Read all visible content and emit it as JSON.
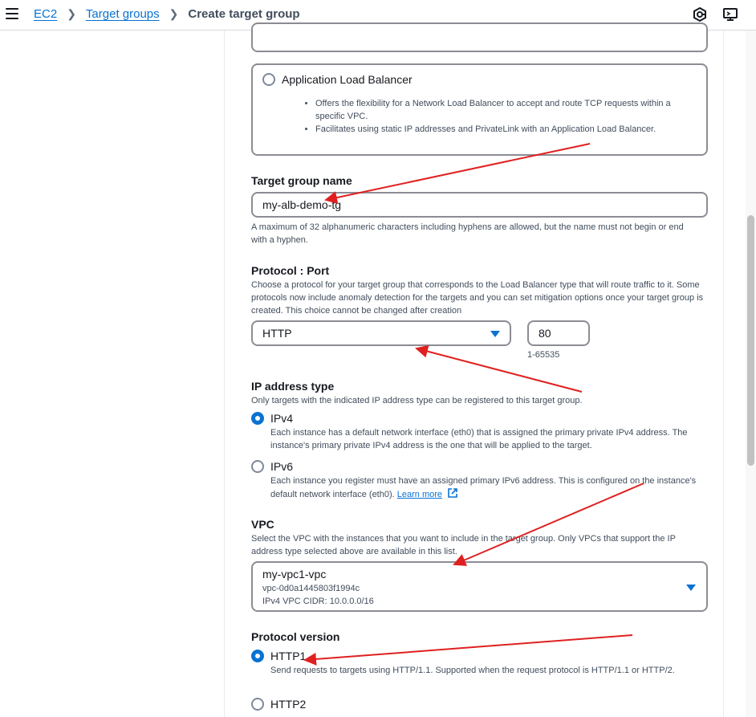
{
  "breadcrumbs": [
    "EC2",
    "Target groups",
    "Create target group"
  ],
  "alb_option": {
    "label": "Application Load Balancer",
    "bullets": [
      "Offers the flexibility for a Network Load Balancer to accept and route TCP requests within a specific VPC.",
      "Facilitates using static IP addresses and PrivateLink with an Application Load Balancer."
    ]
  },
  "target_group_name": {
    "label": "Target group name",
    "value": "my-alb-demo-tg",
    "hint": "A maximum of 32 alphanumeric characters including hyphens are allowed, but the name must not begin or end with a hyphen."
  },
  "protocol_port": {
    "label": "Protocol : Port",
    "description": "Choose a protocol for your target group that corresponds to the Load Balancer type that will route traffic to it. Some protocols now include anomaly detection for the targets and you can set mitigation options once your target group is created. This choice cannot be changed after creation",
    "protocol": "HTTP",
    "port": "80",
    "port_range": "1-65535"
  },
  "ip_address_type": {
    "label": "IP address type",
    "description": "Only targets with the indicated IP address type can be registered to this target group.",
    "ipv4_label": "IPv4",
    "ipv4_desc": "Each instance has a default network interface (eth0) that is assigned the primary private IPv4 address. The instance's primary private IPv4 address is the one that will be applied to the target.",
    "ipv6_label": "IPv6",
    "ipv6_desc": "Each instance you register must have an assigned primary IPv6 address. This is configured on the instance's default network interface (eth0).",
    "learn_more": "Learn more"
  },
  "vpc": {
    "label": "VPC",
    "description": "Select the VPC with the instances that you want to include in the target group. Only VPCs that support the IP address type selected above are available in this list.",
    "name": "my-vpc1-vpc",
    "id": "vpc-0d0a1445803f1994c",
    "cidr": "IPv4 VPC CIDR: 10.0.0.0/16"
  },
  "protocol_version": {
    "label": "Protocol version",
    "http1_label": "HTTP1",
    "http1_desc": "Send requests to targets using HTTP/1.1. Supported when the request protocol is HTTP/1.1 or HTTP/2.",
    "http2_label": "HTTP2"
  },
  "colors": {
    "link": "#0972d3",
    "annotation_arrow": "#e02020",
    "text": "#16191f"
  }
}
